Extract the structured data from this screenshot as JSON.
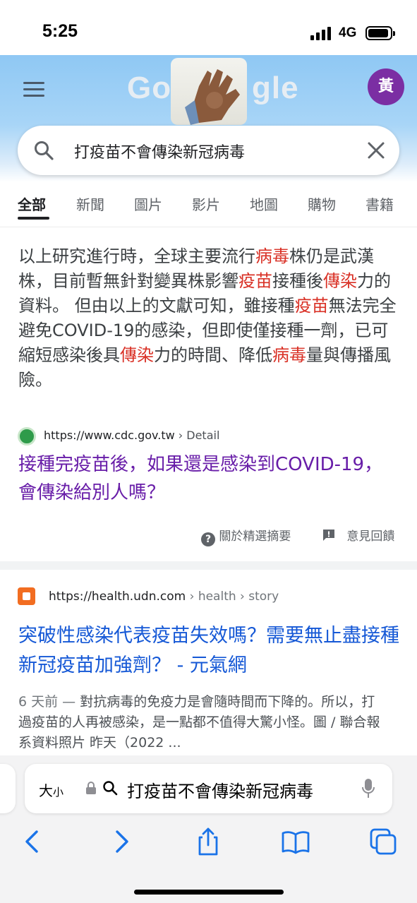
{
  "status_bar": {
    "time": "5:25",
    "network": "4G"
  },
  "header": {
    "doodle_letters_left": "Go",
    "doodle_letters_right": "gle",
    "avatar_letter": "黃"
  },
  "search": {
    "query": "打疫苗不會傳染新冠病毒"
  },
  "tabs": [
    {
      "label": "全部"
    },
    {
      "label": "新聞"
    },
    {
      "label": "圖片"
    },
    {
      "label": "影片"
    },
    {
      "label": "地圖"
    },
    {
      "label": "購物"
    },
    {
      "label": "書籍"
    }
  ],
  "featured_snippet": {
    "parts": [
      {
        "text": "以上研究進行時，全球主要流行",
        "hl": false
      },
      {
        "text": "病毒",
        "hl": true
      },
      {
        "text": "株仍是武漢株，目前暫無針對變異株影響",
        "hl": false
      },
      {
        "text": "疫苗",
        "hl": true
      },
      {
        "text": "接種後",
        "hl": false
      },
      {
        "text": "傳染",
        "hl": true
      },
      {
        "text": "力的資料。 但由以上的文獻可知，雖接種",
        "hl": false
      },
      {
        "text": "疫苗",
        "hl": true
      },
      {
        "text": "無法完全避免COVID-19的感染，但即使僅接種一劑，已可縮短感染後具",
        "hl": false
      },
      {
        "text": "傳染",
        "hl": true
      },
      {
        "text": "力的時間、降低",
        "hl": false
      },
      {
        "text": "病毒",
        "hl": true
      },
      {
        "text": "量與傳播風險。",
        "hl": false
      }
    ],
    "source_url": "https://www.cdc.gov.tw",
    "source_crumb": " › Detail",
    "title": "接種完疫苗後，如果還是感染到COVID-19，會傳染給別人嗎？",
    "about_label": "關於精選摘要",
    "feedback_label": "意見回饋"
  },
  "result2": {
    "url": "https://health.udn.com",
    "crumb": " › health › story",
    "title": "突破性感染代表疫苗失效嗎？需要無止盡接種新冠疫苗加強劑？ - 元氣網",
    "date": "6 天前 — ",
    "snippet": "對抗病毒的免疫力是會隨時間而下降的。所以，打過疫苗的人再被感染，是一點都不值得大驚小怪。圖 / 聯合報系資料照片 昨天（2022 ..."
  },
  "browser": {
    "aa_label_big": "大",
    "aa_label_small": "小",
    "address_text": "打疫苗不會傳染新冠病毒"
  },
  "colors": {
    "highlight": "#d93025",
    "visited_link": "#681da8",
    "link": "#1558d6",
    "avatar_bg": "#7b2ea3"
  }
}
